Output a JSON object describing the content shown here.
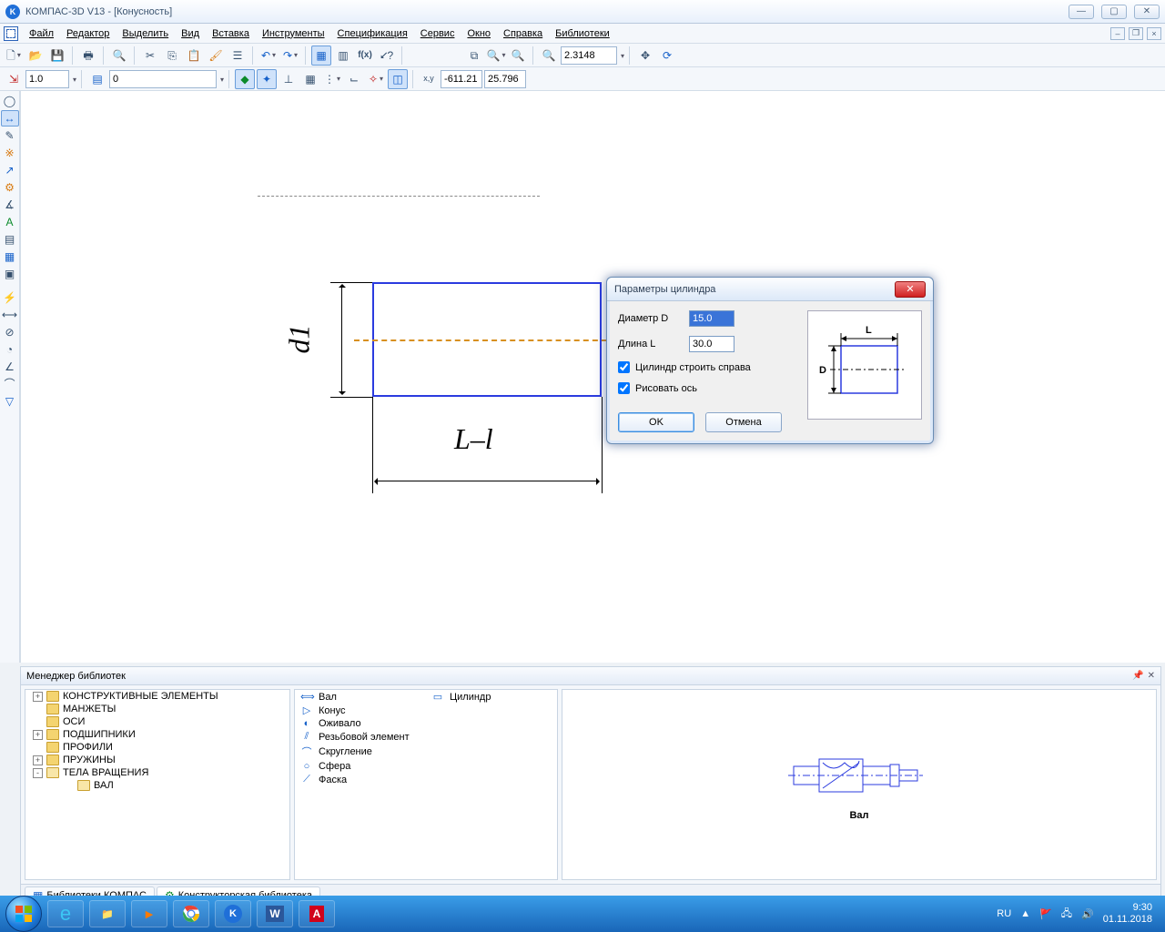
{
  "window": {
    "title": "КОМПАС-3D V13 - [Конусность]",
    "app_icon_letter": "K"
  },
  "menu": [
    "Файл",
    "Редактор",
    "Выделить",
    "Вид",
    "Вставка",
    "Инструменты",
    "Спецификация",
    "Сервис",
    "Окно",
    "Справка",
    "Библиотеки"
  ],
  "toolbar2": {
    "step": "1.0",
    "layer": "0",
    "zoom": "2.3148",
    "coord_x": "-611.21",
    "coord_y": "25.796"
  },
  "drawing": {
    "d1_label": "d1",
    "ll_label": "L–l"
  },
  "dialog": {
    "title": "Параметры цилиндра",
    "diameter_label": "Диаметр D",
    "diameter_value": "15.0",
    "length_label": "Длина L",
    "length_value": "30.0",
    "cb_right": "Цилиндр строить справа",
    "cb_axis": "Рисовать ось",
    "ok": "OK",
    "cancel": "Отмена",
    "preview_L": "L",
    "preview_D": "D"
  },
  "lib_title": "Менеджер библиотек",
  "lib_tree": [
    {
      "exp": "+",
      "label": "КОНСТРУКТИВНЫЕ ЭЛЕМЕНТЫ"
    },
    {
      "exp": "",
      "label": "МАНЖЕТЫ"
    },
    {
      "exp": "",
      "label": "ОСИ"
    },
    {
      "exp": "+",
      "label": "ПОДШИПНИКИ"
    },
    {
      "exp": "",
      "label": "ПРОФИЛИ"
    },
    {
      "exp": "+",
      "label": "ПРУЖИНЫ"
    },
    {
      "exp": "-",
      "label": "ТЕЛА ВРАЩЕНИЯ",
      "open": true
    },
    {
      "exp": "",
      "label": "ВАЛ",
      "child": true,
      "open": true
    }
  ],
  "lib_list_left": [
    "Вал",
    "Конус",
    "Оживало",
    "Резьбовой элемент",
    "Скругление",
    "Сфера",
    "Фаска"
  ],
  "lib_list_right": [
    "Цилиндр"
  ],
  "lib_preview_caption": "Вал",
  "lib_tabs": [
    "Библиотеки КОМПАС",
    "Конструкторская библиотека"
  ],
  "tray": {
    "lang": "RU",
    "time": "9:30",
    "date": "01.11.2018"
  }
}
